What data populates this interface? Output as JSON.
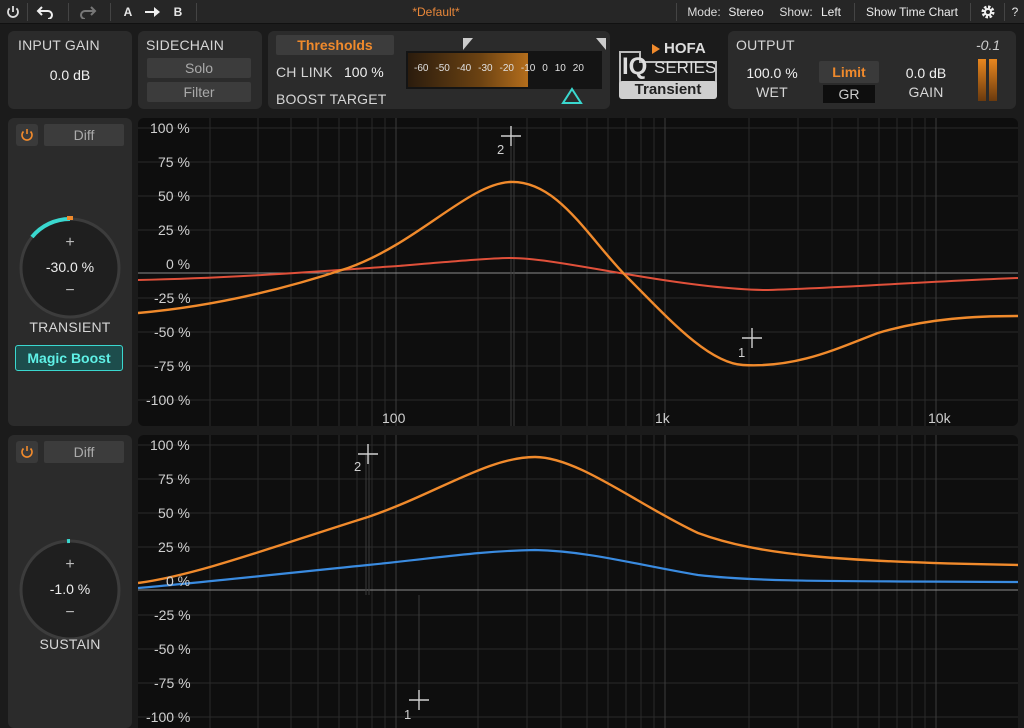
{
  "topbar": {
    "ab_a": "A",
    "ab_b": "B",
    "preset": "*Default*",
    "mode_label": "Mode:",
    "mode_value": "Stereo",
    "show_label": "Show:",
    "show_value": "Left",
    "time_chart": "Show Time Chart",
    "help": "?"
  },
  "input": {
    "label": "INPUT GAIN",
    "value": "0.0 dB"
  },
  "sidechain": {
    "label": "SIDECHAIN",
    "solo": "Solo",
    "filter": "Filter"
  },
  "thresholds": {
    "button": "Thresholds",
    "chlink_label": "CH LINK",
    "chlink_value": "100 %",
    "boost_target": "BOOST TARGET",
    "scale": [
      "-60",
      "-50",
      "-40",
      "-30",
      "-20",
      "-10",
      "0",
      "10",
      "20"
    ]
  },
  "logo": {
    "brand": "HOFA",
    "iq": "IQ",
    "series": "SERIES",
    "product": "Transient"
  },
  "output": {
    "label": "OUTPUT",
    "peak": "-0.1",
    "wet_value": "100.0 %",
    "wet_label": "WET",
    "limit": "Limit",
    "gr": "GR",
    "gain_value": "0.0 dB",
    "gain_label": "GAIN"
  },
  "transient": {
    "diff": "Diff",
    "knob_value": "-30.0 %",
    "plus": "+",
    "minus": "−",
    "label": "TRANSIENT",
    "magic": "Magic Boost",
    "y_labels": [
      "100 %",
      "75 %",
      "50 %",
      "25 %",
      "0 %",
      "-25 %",
      "-50 %",
      "-75 %",
      "-100 %"
    ],
    "freq_labels": [
      "100",
      "1k",
      "10k"
    ],
    "handle1": "1",
    "handle2": "2"
  },
  "sustain": {
    "diff": "Diff",
    "knob_value": "-1.0 %",
    "plus": "+",
    "minus": "−",
    "label": "SUSTAIN",
    "y_labels": [
      "100 %",
      "75 %",
      "50 %",
      "25 %",
      "0 %",
      "-25 %",
      "-50 %",
      "-75 %",
      "-100 %"
    ],
    "handle1": "1",
    "handle2": "2"
  },
  "colors": {
    "accent_orange": "#f08a2c",
    "accent_teal": "#3ad8cf",
    "curve_red": "#e0503a",
    "curve_blue": "#3a8be0"
  }
}
